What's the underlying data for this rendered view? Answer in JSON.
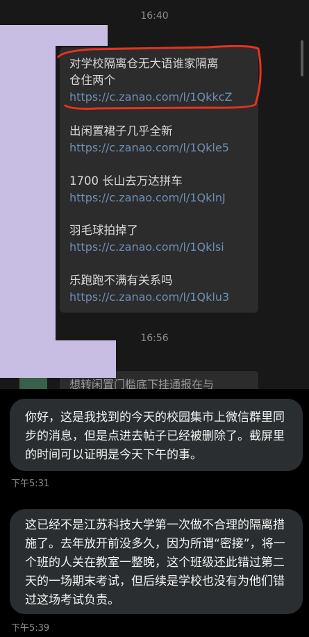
{
  "screenshot": {
    "time_top": "16:40",
    "time_bottom": "16:56",
    "posts": [
      {
        "title": "对学校隔离仓无大语谁家隔离仓住两个",
        "line1": "对学校隔离仓无大语谁家隔离",
        "line2": "仓住两个",
        "url": "https://c.zanao.com/l/1QkkcZ"
      },
      {
        "title": "出闲置裙子几乎全新",
        "url": "https://c.zanao.com/l/1Qkle5"
      },
      {
        "title": "1700 长山去万达拼车",
        "url": "https://c.zanao.com/l/1QklnJ"
      },
      {
        "title": "羽毛球拍掉了",
        "url": "https://c.zanao.com/l/1Qklsi"
      },
      {
        "title": "乐跑跑不满有关系吗",
        "url": "https://c.zanao.com/l/1Qklu3"
      }
    ],
    "cut_off_text": "想转闲置门槛底下挂通报在与",
    "highlight_color": "#e8321e",
    "redaction_color": "#c8bde2"
  },
  "messages": [
    {
      "text": "你好，这是我找到的今天的校园集市上微信群里同步的消息，但是点进去帖子已经被删除了。截屏里的时间可以证明是今天下午的事。",
      "time": "下午5:31"
    },
    {
      "text": "这已经不是江苏科技大学第一次做不合理的隔离措施了。去年放开前没多久，因为所谓“密接”，将一个班的人关在教室一整晚，这个班级还此错过第二天的一场期末考试，但后续是学校也没有为他们错过这场考试负责。",
      "time": "下午5:39"
    }
  ]
}
